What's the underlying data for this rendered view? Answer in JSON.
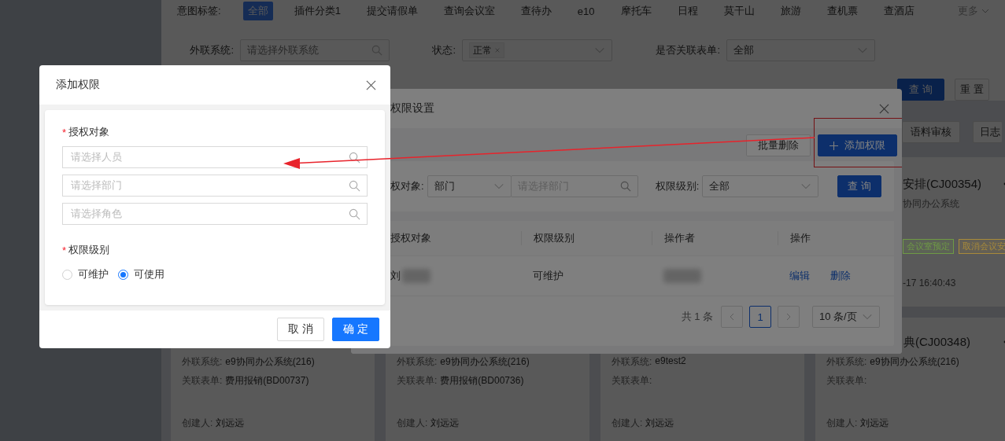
{
  "page": {
    "intent_tags": {
      "label": "意图标签:",
      "items": [
        {
          "label": "全部",
          "selected": true
        },
        {
          "label": "插件分类1",
          "selected": false
        },
        {
          "label": "提交请假单",
          "selected": false
        },
        {
          "label": "查询会议室",
          "selected": false
        },
        {
          "label": "查待办",
          "selected": false
        },
        {
          "label": "e10",
          "selected": false
        },
        {
          "label": "摩托车",
          "selected": false
        },
        {
          "label": "日程",
          "selected": false
        },
        {
          "label": "莫干山",
          "selected": false
        },
        {
          "label": "旅游",
          "selected": false
        },
        {
          "label": "查机票",
          "selected": false
        },
        {
          "label": "查酒店",
          "selected": false
        }
      ],
      "more": "更多"
    },
    "filters": [
      {
        "label": "外联系统:",
        "kind": "search",
        "placeholder": "请选择外联系统"
      },
      {
        "label": "状态:",
        "kind": "tags",
        "tags": [
          "正常"
        ]
      },
      {
        "label": "是否关联表单:",
        "kind": "select",
        "value": "全部"
      }
    ],
    "actions": [
      {
        "label": "查 询",
        "kind": "primary"
      },
      {
        "label": "重 置",
        "kind": "default"
      }
    ],
    "toolbar": [
      "语料审核",
      "日志"
    ],
    "top_card": {
      "title": "安排(CJ00354)",
      "system": "协同办公系统",
      "tags": [
        {
          "label": "会议室预定",
          "color": "#6e9a45"
        },
        {
          "label": "取消会议安",
          "color": "#a88a3a"
        }
      ],
      "time": "-17 16:40:43"
    },
    "cards": [
      {
        "system_label": "外联系统:",
        "system": "e9协同办公系统(216)",
        "form_label": "关联表单:",
        "form": "费用报销(BD00737)",
        "creator_label": "创建人:",
        "creator": "刘远远"
      },
      {
        "system_label": "外联系统:",
        "system": "e9协同办公系统(216)",
        "form_label": "关联表单:",
        "form": "费用报销(BD00736)",
        "creator_label": "创建人:",
        "creator": "刘远远"
      },
      {
        "system_label": "外联系统:",
        "system": "e9test2",
        "form_label": "关联表单:",
        "creator_label": "创建人:",
        "creator": "刘远远"
      },
      {
        "title": "典(CJ00348)",
        "system_label": "外联系统:",
        "system": "e9协同办公系统(216)",
        "form_label": "关联表单:",
        "creator_label": "创建人:",
        "creator": "刘远远"
      }
    ]
  },
  "permission_modal": {
    "title": "权限设置",
    "toolbar": [
      {
        "label": "批量删除",
        "kind": "default",
        "highlighted": false
      },
      {
        "label": "添加权限",
        "kind": "primary",
        "highlighted": true
      }
    ],
    "filter": {
      "object_label": "权对象:",
      "object_type": "部门",
      "placeholder": "请选择部门",
      "level_label": "权限级别:",
      "level": "全部",
      "query": "查 询"
    },
    "table": {
      "columns": [
        "授权对象",
        "权限级别",
        "操作者",
        "操作"
      ],
      "rows": [
        {
          "object": "刘",
          "object_redacted": true,
          "level": "可维护",
          "operator_redacted": true,
          "actions": [
            "编辑",
            "删除"
          ]
        }
      ]
    },
    "pagination": {
      "total": "共 1 条",
      "pages": [
        {
          "label": "1",
          "selected": true
        }
      ],
      "page_size": "10 条/页"
    }
  },
  "add_modal": {
    "title": "添加权限",
    "fields": [
      {
        "label": "授权对象",
        "required_mark": "*",
        "kind": "inputs",
        "placeholders": [
          "请选择人员",
          "请选择部门",
          "请选择角色"
        ]
      },
      {
        "label": "权限级别",
        "required_mark": "*",
        "kind": "radio",
        "options": [
          {
            "label": "可维护",
            "selected": false
          },
          {
            "label": "可使用",
            "selected": true
          }
        ]
      }
    ],
    "buttons": [
      {
        "label": "取 消",
        "kind": "default"
      },
      {
        "label": "确 定",
        "kind": "primary"
      }
    ]
  }
}
